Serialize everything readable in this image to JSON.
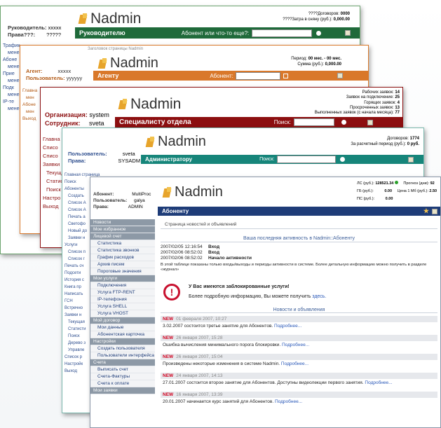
{
  "w1": {
    "user_label": "Руководитель:",
    "user_value": "xxxxx",
    "rights_label": "Права???:",
    "rights_value": "?????",
    "logo": "Nadmin",
    "stat1_label": "????Договоров:",
    "stat1_value": "0000",
    "stat2_label": "????Затра в сняну (руб.):",
    "stat2_value": "0,000.00",
    "bar_title": "Руководителю",
    "search_label": "Абонент или что-то еще?:",
    "side": [
      "Трафик",
      "мене",
      "Абоне",
      "мене",
      "Прие",
      "мене",
      "Подк",
      "мене",
      "IP-те",
      "мене"
    ]
  },
  "w2": {
    "user_label": "Агент:",
    "user_value": "xxxxx",
    "rights_label": "Пользователь:",
    "rights_value": "yyyyyy",
    "logo": "Nadmin",
    "stat1_label": "Период:",
    "stat1_value": "00 мес. - 00 мес.",
    "stat2_label": "Сумма (руб.):",
    "stat2_value": "0,000.00",
    "bar_title": "Агенту",
    "search_label": "Абонент:",
    "top_note": "Заголовок страницы Nadmin",
    "side": [
      "Главна",
      "мен",
      "Абоне",
      "мен",
      "Выход"
    ]
  },
  "w3": {
    "org_label": "Организация:",
    "org_value": "system",
    "emp_label": "Сотрудник:",
    "emp_value": "sveta",
    "logo": "Nadmin",
    "stats": [
      {
        "label": "Рабочих заявок:",
        "value": "14"
      },
      {
        "label": "Заявок на подключение:",
        "value": "25"
      },
      {
        "label": "Горящих заявок:",
        "value": "4"
      },
      {
        "label": "Просроченных заявок:",
        "value": "13"
      },
      {
        "label": "Выполненных заявок (с начала месяца):",
        "value": "77"
      }
    ],
    "bar_title": "Специалисту отдела",
    "search_label": "Поиск:",
    "side": [
      "Главна",
      "Списо",
      "Списо",
      "Заявки",
      "Текущ",
      "Статис",
      "Поиск",
      "Настро",
      "Выход"
    ]
  },
  "w4": {
    "user_label": "Пользователь:",
    "user_value": "sveta",
    "rights_label": "Права:",
    "rights_value": "SYSADM",
    "logo": "Nadmin",
    "stat1_label": "Договоров:",
    "stat1_value": "1774",
    "stat2_label": "За расчетный период (руб.):",
    "stat2_value": "0 руб.",
    "bar_title": "Администратору",
    "search_label": "Поиск:",
    "side": [
      "Главная страница",
      "Поиск",
      "Абоненты",
      "Создать",
      "Список А",
      "Список А",
      "Печать а",
      "Светофо",
      "Новый до",
      "Заявки н",
      "Услуги",
      "Список п",
      "Список г",
      "Печать сч",
      "Подсети",
      "История с",
      "Книга пр",
      "Написать",
      "ГСН",
      "Встречно",
      "Заявки н",
      "Текущая",
      "Статисти",
      "Поиск",
      "Дерево з",
      "Управле",
      "Список р",
      "Настройк",
      "Выход"
    ]
  },
  "w5": {
    "abonent_label": "Абонент:",
    "abonent_value": "MultiProc",
    "user_label": "Пользователь:",
    "user_value": "galya",
    "rights_label": "Права:",
    "rights_value": "ADMIN",
    "logo": "Nadmin",
    "bar_title": "Абоненту",
    "account_label": "ЛС (руб.):",
    "account_value": "128521.34",
    "forecast_label": "Прогноз (дни):",
    "forecast_value": "92",
    "gb_label": "ГБ (руб.):",
    "gb_value": "0.00",
    "price_label": "Цена 1 Мб (руб.):",
    "price_value": "2.50",
    "ps_label": "ПС (руб.):",
    "ps_value": "0.00",
    "menu": [
      {
        "t": "Новости",
        "s": true
      },
      {
        "t": "Мое избранное",
        "s": true
      },
      {
        "t": "Лицевой счет",
        "s": true
      },
      {
        "t": "Статистика",
        "s": false
      },
      {
        "t": "Статистика звонков",
        "s": false
      },
      {
        "t": "График расходов",
        "s": false
      },
      {
        "t": "Архив писем",
        "s": false
      },
      {
        "t": "Пороговые значения",
        "s": false
      },
      {
        "t": "Мои услуги",
        "s": true
      },
      {
        "t": "Подключения",
        "s": false
      },
      {
        "t": "Услуга FTP-RENT",
        "s": false
      },
      {
        "t": "IP-телефония",
        "s": false
      },
      {
        "t": "Услуга SHELL",
        "s": false
      },
      {
        "t": "Услуга VHOST",
        "s": false
      },
      {
        "t": "Мой договор",
        "s": true
      },
      {
        "t": "Мои данные",
        "s": false
      },
      {
        "t": "Абонентская карточка",
        "s": false
      },
      {
        "t": "Настройки",
        "s": true
      },
      {
        "t": "Создать пользователя",
        "s": false
      },
      {
        "t": "Пользователи интерфейса",
        "s": false
      },
      {
        "t": "Счета",
        "s": true
      },
      {
        "t": "Выписать счет",
        "s": false
      },
      {
        "t": "Счета-Фактуры",
        "s": false
      },
      {
        "t": "Счета к оплате",
        "s": false
      },
      {
        "t": "Мои заявки",
        "s": true
      }
    ],
    "page_title": "Страница новостей и объявлений",
    "activity_title": "Ваша последняя активность в Nadmin::Абоненту",
    "activity": [
      {
        "date": "2007/02/05 12:16:54",
        "event": "Вход"
      },
      {
        "date": "2007/02/06 08:52:02",
        "event": "Вход"
      },
      {
        "date": "2007/02/06 08:52:02",
        "event": "Начало активности"
      }
    ],
    "activity_note": "В этой таблице показаны только входы/выходы и периоды активности в системе. Более детальную информацию можно получить в разделе «журнал»",
    "alert_title": "У Вас имеются заблокированные услуги!",
    "alert_text": "Более подробную информацию, Вы можете получить",
    "alert_link": "здесь.",
    "news_title": "Новости и объявления",
    "news": [
      {
        "tag": "NEW",
        "date": "01 февраля 2007, 10:27",
        "text": "3.02.2007 состоится третье занятие для Абонентов.",
        "more": "Подробнее..."
      },
      {
        "tag": "NEW",
        "date": "26 января 2007, 15:28",
        "text": "Ошибка вычисления минимального порога блокировки.",
        "more": "Подробнее..."
      },
      {
        "tag": "NEW",
        "date": "26 января 2007, 15:04",
        "text": "Произведены некоторые изменения в системе Nadmin.",
        "more": "Подробнее..."
      },
      {
        "tag": "NEW",
        "date": "24 января 2007, 14:13",
        "text": "27.01.2007 состоится второе занятие для Абонентов. Доступны видеолекции первого занятия.",
        "more": "Подробнее..."
      },
      {
        "tag": "NEW",
        "date": "16 января 2007, 13:39",
        "text": "20.01.2007 начинается курс занятий для Абонентов.",
        "more": "Подробнее..."
      }
    ]
  },
  "colors": {
    "green": "#1f6a3a",
    "orange": "#d9782a",
    "red": "#8c0f10",
    "teal": "#16857a",
    "blue": "#2f4f8f",
    "navy": "#1e3c78"
  }
}
